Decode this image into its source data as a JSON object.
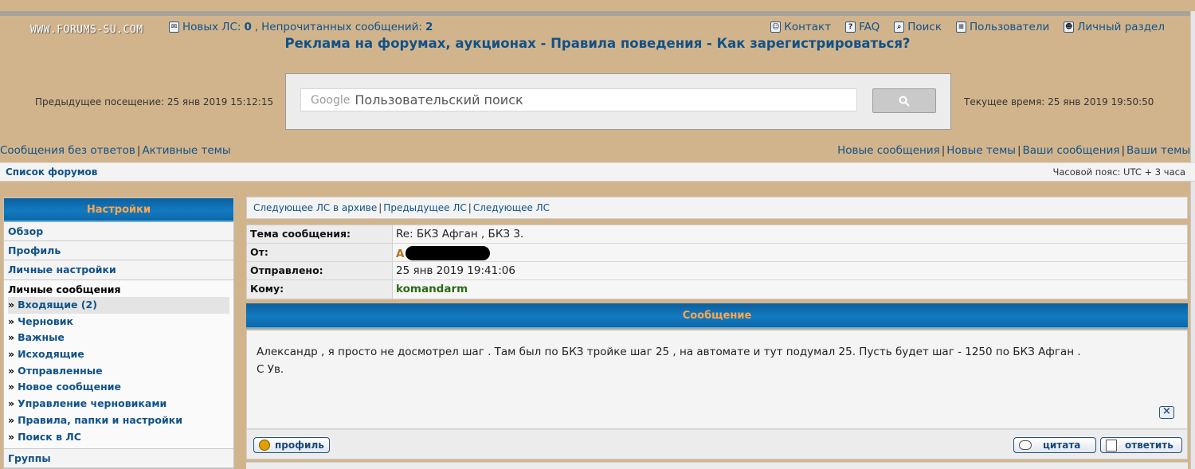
{
  "watermark": "WWW.FORUMS-SU.COM",
  "top_nav": {
    "new_pm_label": "Новых ЛС:",
    "new_pm_count": "0",
    "unread_label": "Непрочитанных сообщений:",
    "unread_count": "2",
    "right_links": [
      "Контакт",
      "FAQ",
      "Поиск",
      "Пользователи",
      "Личный раздел"
    ]
  },
  "headline": {
    "links": [
      "Реклама на форумах, аукционах",
      "Правила поведения",
      "Как зарегистрироваться?"
    ],
    "separator": " - "
  },
  "search": {
    "previous_visit": "Предыдущее посещение: 25 янв 2019 15:12:15",
    "current_time": "Текущее время: 25 янв 2019 19:50:50",
    "google_label": "Google",
    "placeholder": "Пользовательский поиск"
  },
  "quick_links": {
    "left": [
      "Сообщения без ответов",
      "Активные темы"
    ],
    "right": [
      "Новые сообщения",
      "Новые темы",
      "Ваши сообщения",
      "Ваши темы"
    ]
  },
  "breadcrumb": {
    "home": "Список форумов",
    "timezone": "Часовой пояс: UTC + 3 часа"
  },
  "sidebar": {
    "title": "Настройки",
    "items": [
      "Обзор",
      "Профиль",
      "Личные настройки"
    ],
    "section_title": "Личные сообщения",
    "sub_items": [
      "Входящие (2)",
      "Черновик",
      "Важные",
      "Исходящие",
      "Отправленные",
      "Новое сообщение",
      "Управление черновиками",
      "Правила, папки и настройки",
      "Поиск в ЛС"
    ],
    "bottom_item": "Группы"
  },
  "message_nav": [
    "Следующее ЛС в архиве",
    "Предыдущее ЛС",
    "Следующее ЛС"
  ],
  "message_info": {
    "subject_label": "Тема сообщения:",
    "subject": "Re: БКЗ Афган , БКЗ 3.",
    "from_label": "От:",
    "from_initial": "А",
    "sent_label": "Отправлено:",
    "sent": "25 янв 2019 19:41:06",
    "to_label": "Кому:",
    "to": "komandarm"
  },
  "message": {
    "header": "Сообщение",
    "line1": "Александр , я просто не досмотрел шаг . Там был по БКЗ тройке шаг 25 , на автомате и тут подумал 25. Пусть будет шаг - 1250 по БКЗ Афган .",
    "line2": "С Ув."
  },
  "buttons": {
    "profile": "профиль",
    "quote": "цитата",
    "reply": "ответить"
  },
  "colors": {
    "page_bg": "#d2b48c",
    "header_blue": "#137ac0",
    "header_text": "#ffa64d",
    "link": "#105289"
  }
}
